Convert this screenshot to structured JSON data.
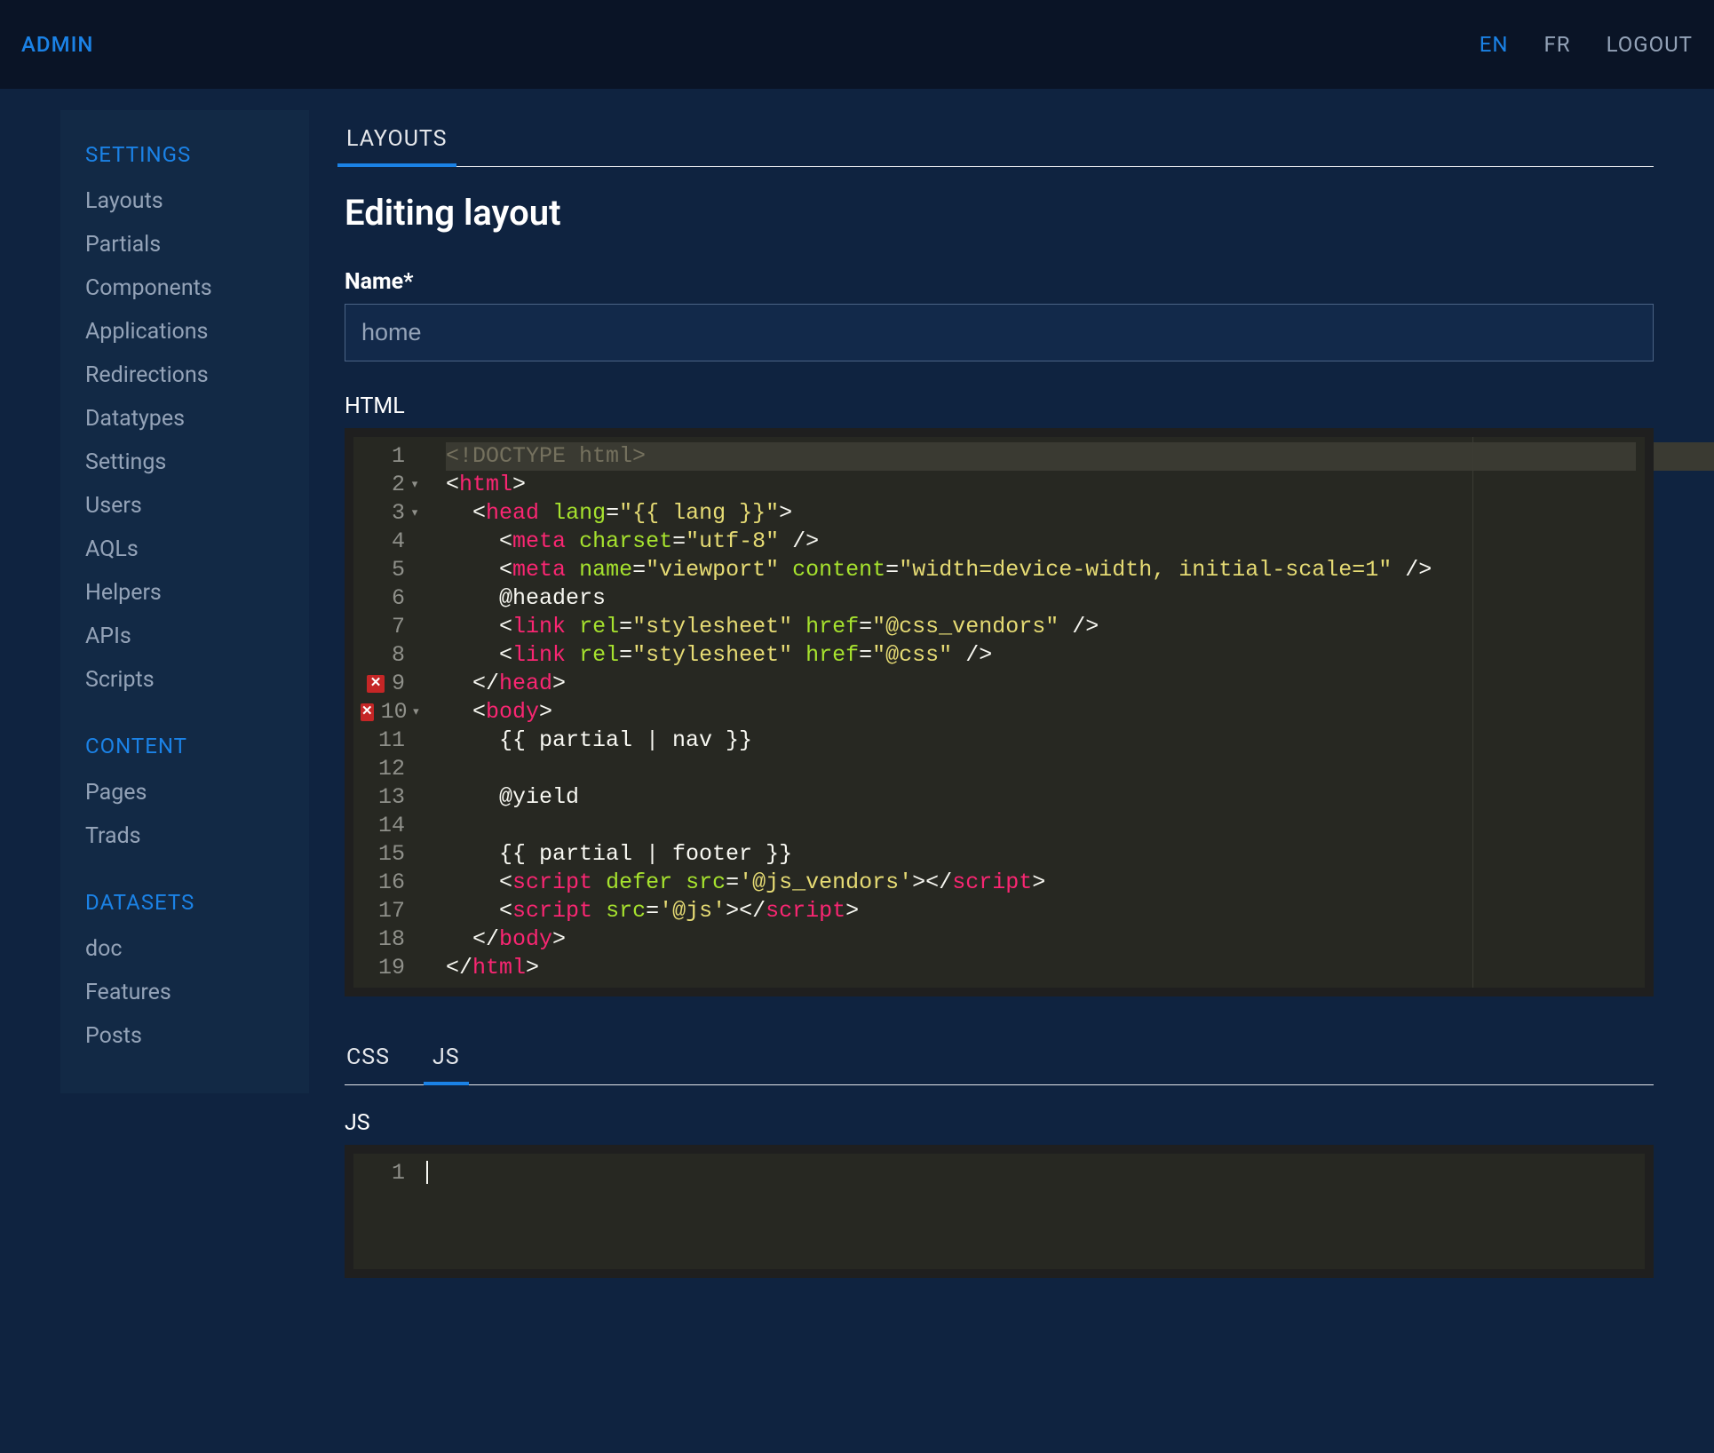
{
  "header": {
    "brand": "ADMIN",
    "langs": {
      "en": "EN",
      "fr": "FR"
    },
    "logout": "LOGOUT",
    "active_lang": "en"
  },
  "sidebar": {
    "groups": [
      {
        "title": "SETTINGS",
        "items": [
          "Layouts",
          "Partials",
          "Components",
          "Applications",
          "Redirections",
          "Datatypes",
          "Settings",
          "Users",
          "AQLs",
          "Helpers",
          "APIs",
          "Scripts"
        ]
      },
      {
        "title": "CONTENT",
        "items": [
          "Pages",
          "Trads"
        ]
      },
      {
        "title": "DATASETS",
        "items": [
          "doc",
          "Features",
          "Posts"
        ]
      }
    ]
  },
  "main": {
    "top_tabs": {
      "items": [
        "LAYOUTS"
      ],
      "active_index": 0
    },
    "page_title": "Editing layout",
    "name_field": {
      "label": "Name*",
      "value": "home"
    },
    "html_section": {
      "label": "HTML",
      "gutter": [
        {
          "n": 1,
          "fold": false,
          "err": false
        },
        {
          "n": 2,
          "fold": true,
          "err": false
        },
        {
          "n": 3,
          "fold": true,
          "err": false
        },
        {
          "n": 4,
          "fold": false,
          "err": false
        },
        {
          "n": 5,
          "fold": false,
          "err": false
        },
        {
          "n": 6,
          "fold": false,
          "err": false
        },
        {
          "n": 7,
          "fold": false,
          "err": false
        },
        {
          "n": 8,
          "fold": false,
          "err": false
        },
        {
          "n": 9,
          "fold": false,
          "err": true
        },
        {
          "n": 10,
          "fold": true,
          "err": true
        },
        {
          "n": 11,
          "fold": false,
          "err": false
        },
        {
          "n": 12,
          "fold": false,
          "err": false
        },
        {
          "n": 13,
          "fold": false,
          "err": false
        },
        {
          "n": 14,
          "fold": false,
          "err": false
        },
        {
          "n": 15,
          "fold": false,
          "err": false
        },
        {
          "n": 16,
          "fold": false,
          "err": false
        },
        {
          "n": 17,
          "fold": false,
          "err": false
        },
        {
          "n": 18,
          "fold": false,
          "err": false
        },
        {
          "n": 19,
          "fold": false,
          "err": false
        }
      ],
      "lines": [
        {
          "hl": true,
          "tokens": [
            {
              "c": "t-dt",
              "t": "<!DOCTYPE html>"
            }
          ]
        },
        {
          "tokens": [
            {
              "c": "t-op",
              "t": "<"
            },
            {
              "c": "t-tag",
              "t": "html"
            },
            {
              "c": "t-op",
              "t": ">"
            }
          ]
        },
        {
          "indent": 2,
          "tokens": [
            {
              "c": "t-op",
              "t": "<"
            },
            {
              "c": "t-tag",
              "t": "head"
            },
            {
              "c": "t-txt",
              "t": " "
            },
            {
              "c": "t-attr",
              "t": "lang"
            },
            {
              "c": "t-op",
              "t": "="
            },
            {
              "c": "t-str",
              "t": "\"{{ lang }}\""
            },
            {
              "c": "t-op",
              "t": ">"
            }
          ]
        },
        {
          "indent": 4,
          "tokens": [
            {
              "c": "t-op",
              "t": "<"
            },
            {
              "c": "t-tag",
              "t": "meta"
            },
            {
              "c": "t-txt",
              "t": " "
            },
            {
              "c": "t-attr",
              "t": "charset"
            },
            {
              "c": "t-op",
              "t": "="
            },
            {
              "c": "t-str",
              "t": "\"utf-8\""
            },
            {
              "c": "t-txt",
              "t": " "
            },
            {
              "c": "t-op",
              "t": "/>"
            }
          ]
        },
        {
          "indent": 4,
          "tokens": [
            {
              "c": "t-op",
              "t": "<"
            },
            {
              "c": "t-tag",
              "t": "meta"
            },
            {
              "c": "t-txt",
              "t": " "
            },
            {
              "c": "t-attr",
              "t": "name"
            },
            {
              "c": "t-op",
              "t": "="
            },
            {
              "c": "t-str",
              "t": "\"viewport\""
            },
            {
              "c": "t-txt",
              "t": " "
            },
            {
              "c": "t-attr",
              "t": "content"
            },
            {
              "c": "t-op",
              "t": "="
            },
            {
              "c": "t-str",
              "t": "\"width=device-width, initial-scale=1\""
            },
            {
              "c": "t-txt",
              "t": " "
            },
            {
              "c": "t-op",
              "t": "/>"
            }
          ]
        },
        {
          "indent": 4,
          "tokens": [
            {
              "c": "t-txt",
              "t": "@headers"
            }
          ]
        },
        {
          "indent": 4,
          "tokens": [
            {
              "c": "t-op",
              "t": "<"
            },
            {
              "c": "t-tag",
              "t": "link"
            },
            {
              "c": "t-txt",
              "t": " "
            },
            {
              "c": "t-attr",
              "t": "rel"
            },
            {
              "c": "t-op",
              "t": "="
            },
            {
              "c": "t-str",
              "t": "\"stylesheet\""
            },
            {
              "c": "t-txt",
              "t": " "
            },
            {
              "c": "t-attr",
              "t": "href"
            },
            {
              "c": "t-op",
              "t": "="
            },
            {
              "c": "t-str",
              "t": "\"@css_vendors\""
            },
            {
              "c": "t-txt",
              "t": " "
            },
            {
              "c": "t-op",
              "t": "/>"
            }
          ]
        },
        {
          "indent": 4,
          "tokens": [
            {
              "c": "t-op",
              "t": "<"
            },
            {
              "c": "t-tag",
              "t": "link"
            },
            {
              "c": "t-txt",
              "t": " "
            },
            {
              "c": "t-attr",
              "t": "rel"
            },
            {
              "c": "t-op",
              "t": "="
            },
            {
              "c": "t-str",
              "t": "\"stylesheet\""
            },
            {
              "c": "t-txt",
              "t": " "
            },
            {
              "c": "t-attr",
              "t": "href"
            },
            {
              "c": "t-op",
              "t": "="
            },
            {
              "c": "t-str",
              "t": "\"@css\""
            },
            {
              "c": "t-txt",
              "t": " "
            },
            {
              "c": "t-op",
              "t": "/>"
            }
          ]
        },
        {
          "indent": 2,
          "tokens": [
            {
              "c": "t-op",
              "t": "</"
            },
            {
              "c": "t-tag",
              "t": "head"
            },
            {
              "c": "t-op",
              "t": ">"
            }
          ]
        },
        {
          "indent": 2,
          "tokens": [
            {
              "c": "t-op",
              "t": "<"
            },
            {
              "c": "t-tag",
              "t": "body"
            },
            {
              "c": "t-op",
              "t": ">"
            }
          ]
        },
        {
          "indent": 4,
          "tokens": [
            {
              "c": "t-txt",
              "t": "{{ partial | nav }}"
            }
          ]
        },
        {
          "indent": 4,
          "tokens": []
        },
        {
          "indent": 4,
          "tokens": [
            {
              "c": "t-txt",
              "t": "@yield"
            }
          ]
        },
        {
          "indent": 4,
          "tokens": []
        },
        {
          "indent": 4,
          "tokens": [
            {
              "c": "t-txt",
              "t": "{{ partial | footer }}"
            }
          ]
        },
        {
          "indent": 4,
          "tokens": [
            {
              "c": "t-op",
              "t": "<"
            },
            {
              "c": "t-tag",
              "t": "script"
            },
            {
              "c": "t-txt",
              "t": " "
            },
            {
              "c": "t-attr",
              "t": "defer"
            },
            {
              "c": "t-txt",
              "t": " "
            },
            {
              "c": "t-attr",
              "t": "src"
            },
            {
              "c": "t-op",
              "t": "="
            },
            {
              "c": "t-str",
              "t": "'@js_vendors'"
            },
            {
              "c": "t-op",
              "t": "></"
            },
            {
              "c": "t-tag",
              "t": "script"
            },
            {
              "c": "t-op",
              "t": ">"
            }
          ]
        },
        {
          "indent": 4,
          "tokens": [
            {
              "c": "t-op",
              "t": "<"
            },
            {
              "c": "t-tag",
              "t": "script"
            },
            {
              "c": "t-txt",
              "t": " "
            },
            {
              "c": "t-attr",
              "t": "src"
            },
            {
              "c": "t-op",
              "t": "="
            },
            {
              "c": "t-str",
              "t": "'@js'"
            },
            {
              "c": "t-op",
              "t": "></"
            },
            {
              "c": "t-tag",
              "t": "script"
            },
            {
              "c": "t-op",
              "t": ">"
            }
          ]
        },
        {
          "indent": 2,
          "tokens": [
            {
              "c": "t-op",
              "t": "</"
            },
            {
              "c": "t-tag",
              "t": "body"
            },
            {
              "c": "t-op",
              "t": ">"
            }
          ]
        },
        {
          "tokens": [
            {
              "c": "t-op",
              "t": "</"
            },
            {
              "c": "t-tag",
              "t": "html"
            },
            {
              "c": "t-op",
              "t": ">"
            }
          ]
        }
      ]
    },
    "sub_tabs": {
      "items": [
        "CSS",
        "JS"
      ],
      "active_index": 1
    },
    "js_section": {
      "label": "JS",
      "gutter": [
        "1"
      ]
    }
  }
}
